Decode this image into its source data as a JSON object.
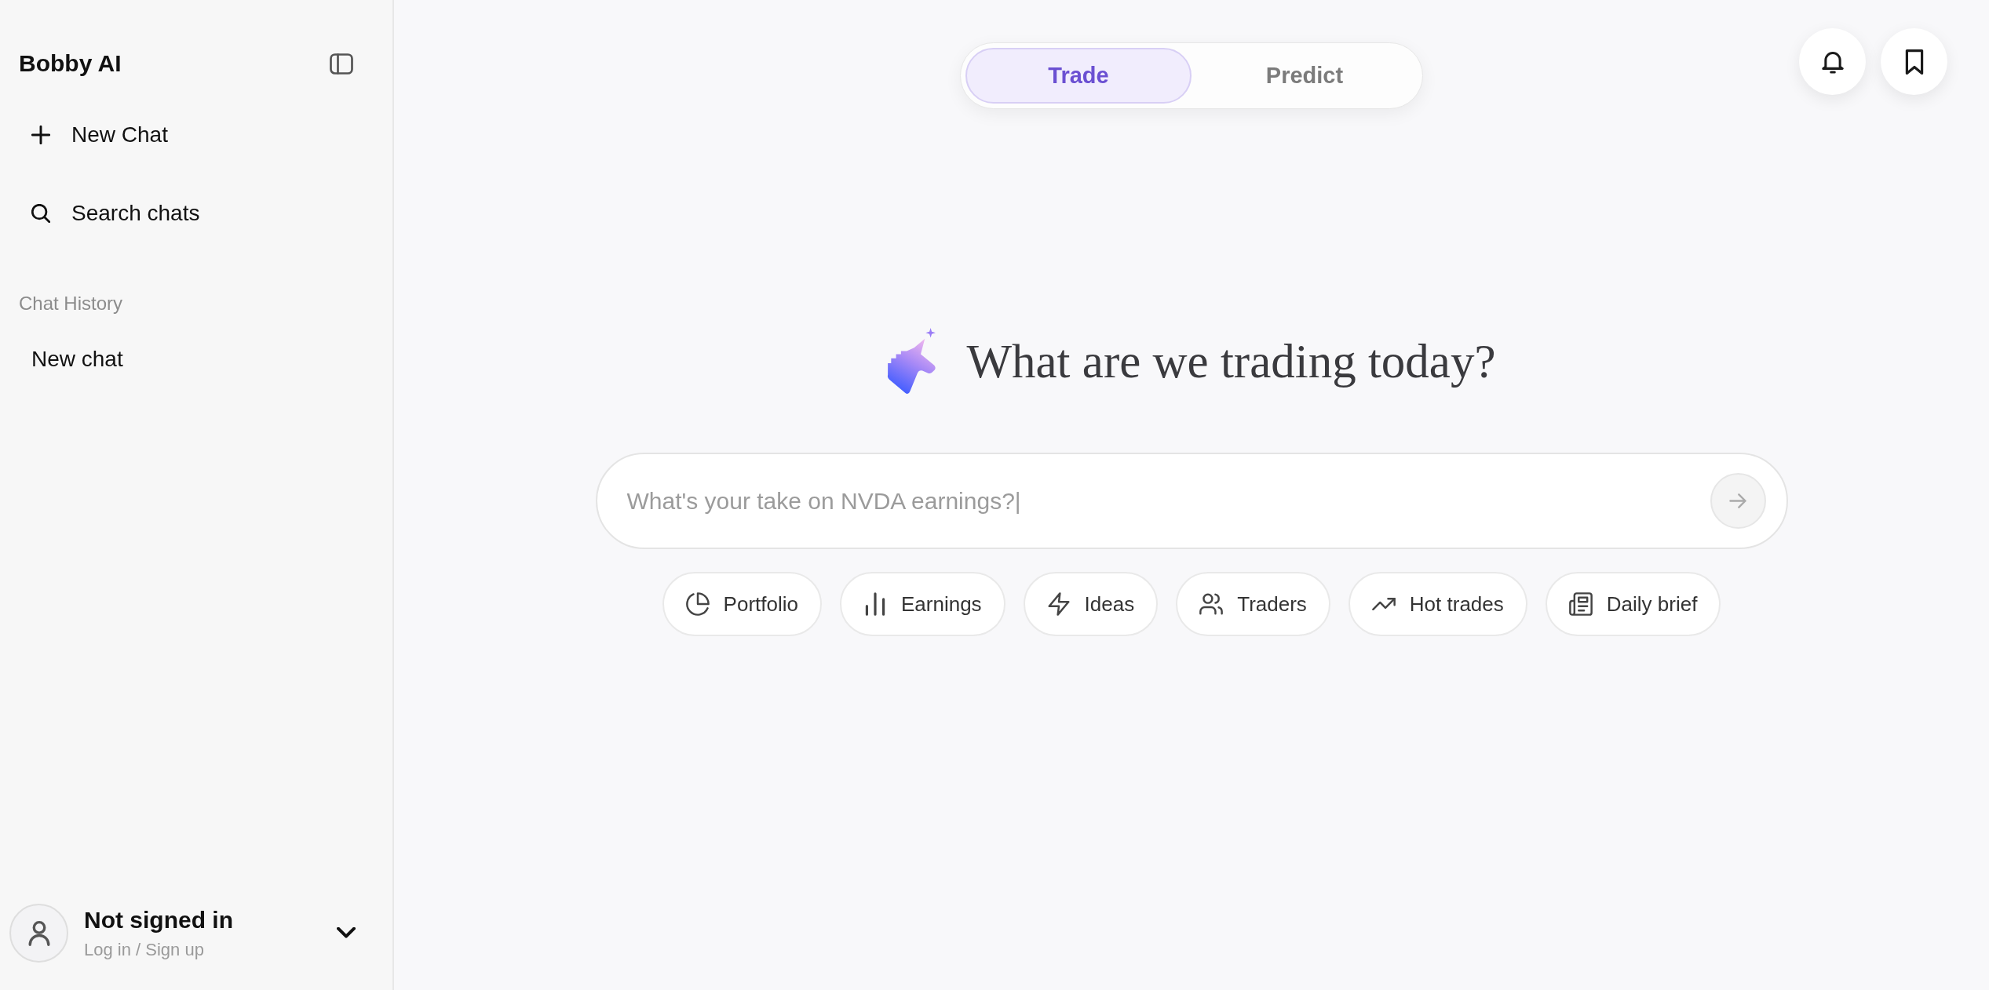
{
  "sidebar": {
    "title": "Bobby AI",
    "actions": [
      {
        "kind": "new",
        "label": "New Chat"
      },
      {
        "kind": "search",
        "label": "Search chats"
      }
    ],
    "history_heading": "Chat History",
    "history": [
      {
        "label": "New chat",
        "selected": false
      }
    ],
    "account": {
      "name": "Not signed in",
      "subtitle": "Log in / Sign up"
    }
  },
  "mode_toggle": [
    {
      "label": "Trade",
      "selected": true
    },
    {
      "label": "Predict",
      "selected": false
    }
  ],
  "heading": "What are we trading today?",
  "composer": {
    "placeholder": "What's your take on NVDA earnings?|",
    "send_button": {
      "disabled": true
    }
  },
  "suggestions": [
    {
      "kind": "portfolio",
      "label": "Portfolio"
    },
    {
      "kind": "earnings",
      "label": "Earnings"
    },
    {
      "kind": "ideas",
      "label": "Ideas"
    },
    {
      "kind": "traders",
      "label": "Traders"
    },
    {
      "kind": "trending",
      "label": "Hot trades"
    },
    {
      "kind": "brief",
      "label": "Daily brief"
    }
  ]
}
